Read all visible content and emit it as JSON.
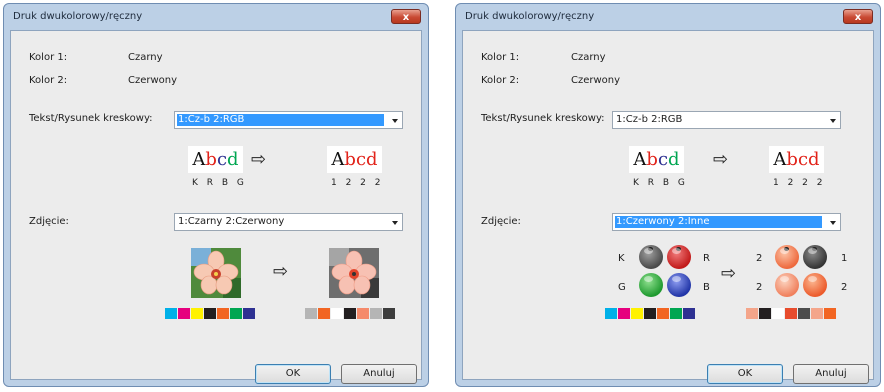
{
  "left": {
    "title": "Druk dwukolorowy/ręczny",
    "close_label": "x",
    "color1_label": "Kolor 1:",
    "color1_value": "Czarny",
    "color2_label": "Kolor 2:",
    "color2_value": "Czerwony",
    "text_label": "Tekst/Rysunek kreskowy:",
    "text_combo": "1:Cz-b 2:RGB",
    "sample_before_caption": "K R B G",
    "sample_after_caption": "1 2 2 2",
    "arrow": "⇨",
    "photo_label": "Zdjęcie:",
    "photo_combo": "1:Czarny 2:Czerwony",
    "ok_label": "OK",
    "cancel_label": "Anuluj",
    "strip_before": [
      "#00b0e8",
      "#e6007e",
      "#fff200",
      "#231f20",
      "#f26522",
      "#00a651",
      "#2e3192"
    ],
    "strip_after": [
      "#b5b5b5",
      "#f26522",
      "#ffffff",
      "#231f20",
      "#f58a6b",
      "#b5b5b5",
      "#3d3d3d"
    ]
  },
  "right": {
    "title": "Druk dwukolorowy/ręczny",
    "close_label": "x",
    "color1_label": "Kolor 1:",
    "color1_value": "Czarny",
    "color2_label": "Kolor 2:",
    "color2_value": "Czerwony",
    "text_label": "Tekst/Rysunek kreskowy:",
    "text_combo": "1:Cz-b 2:RGB",
    "sample_before_caption": "K R B G",
    "sample_after_caption": "1 2 2 2",
    "arrow": "⇨",
    "photo_label": "Zdjęcie:",
    "photo_combo": "1:Czerwony 2:Inne",
    "balls_before_labels": {
      "k": "K",
      "r": "R",
      "g": "G",
      "b": "B"
    },
    "balls_after_labels": {
      "tl": "2",
      "tr": "1",
      "bl": "2",
      "br": "2"
    },
    "ok_label": "OK",
    "cancel_label": "Anuluj",
    "strip_before": [
      "#00b0e8",
      "#e6007e",
      "#fff200",
      "#231f20",
      "#f26522",
      "#00a651",
      "#2e3192"
    ],
    "strip_after": [
      "#f4a58a",
      "#231f20",
      "#ffffff",
      "#e84c2d",
      "#4d4d4d",
      "#f4a58a",
      "#f26522"
    ]
  },
  "colors": {
    "abcd_letters": [
      "#111111",
      "#e2231a",
      "#2e3192",
      "#00a651"
    ],
    "abcd_letters_converted": [
      "#111111",
      "#e2231a",
      "#e2231a",
      "#e2231a"
    ]
  }
}
